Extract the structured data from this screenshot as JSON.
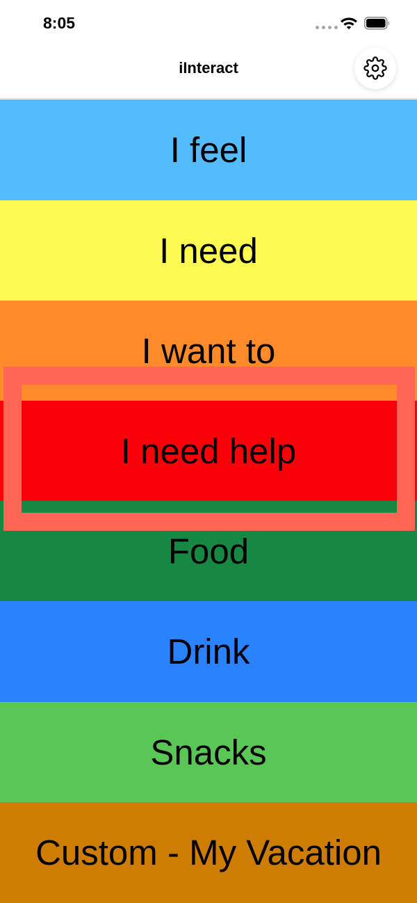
{
  "status_bar": {
    "time": "8:05",
    "icons": [
      "cellular-dots-icon",
      "wifi-icon",
      "battery-icon"
    ]
  },
  "nav": {
    "title": "iInteract",
    "settings_icon": "gear-icon"
  },
  "categories": [
    {
      "label": "I feel",
      "color": "#55bbff"
    },
    {
      "label": "I need",
      "color": "#fdfb52"
    },
    {
      "label": "I want to",
      "color": "#fe8a2a"
    },
    {
      "label": "I need help",
      "color": "#fa0009"
    },
    {
      "label": "Food",
      "color": "#168844"
    },
    {
      "label": "Drink",
      "color": "#2a82ff"
    },
    {
      "label": "Snacks",
      "color": "#5ac656"
    },
    {
      "label": "Custom - My Vacation",
      "color": "#cf7c02"
    }
  ],
  "highlight": {
    "target": "I need help",
    "color": "#ff6655"
  }
}
